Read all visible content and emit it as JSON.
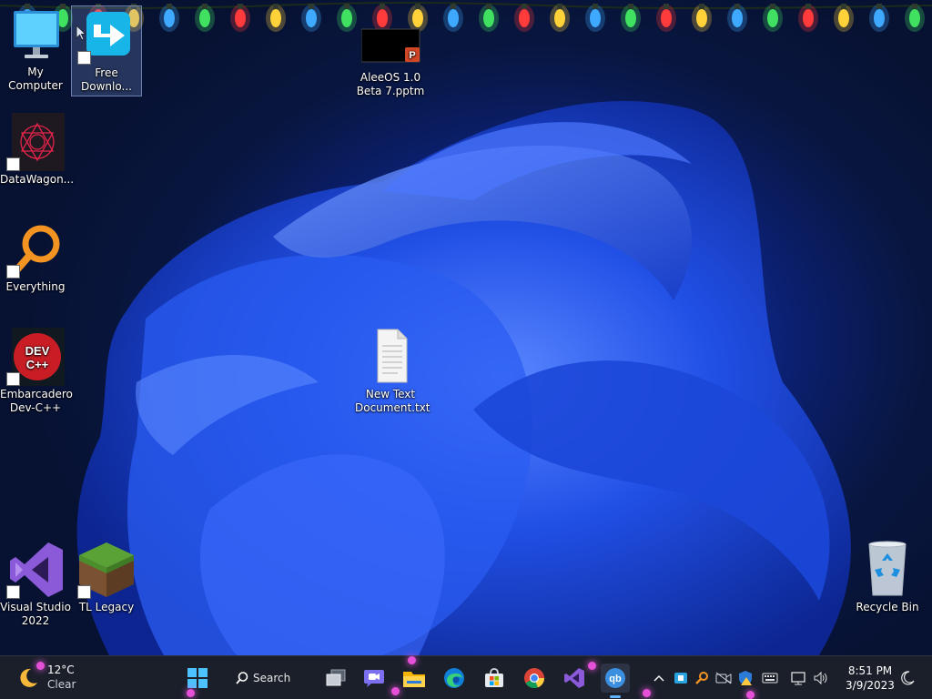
{
  "desktop": {
    "icons": {
      "my_computer": "My Computer",
      "free_download": "Free\nDownlo...",
      "aleeos": "AleeOS 1.0\nBeta 7.pptm",
      "datawagon": "DataWagon...",
      "everything": "Everything",
      "devcpp": "Embarcadero\nDev-C++",
      "new_text": "New Text\nDocument.txt",
      "visual_studio": "Visual Studio\n2022",
      "tl_legacy": "TL Legacy",
      "recycle_bin": "Recycle Bin"
    }
  },
  "taskbar": {
    "weather": {
      "temp": "12°C",
      "condition": "Clear",
      "icon": "moon-icon"
    },
    "search_label": "Search",
    "pinned": [
      "windows-start",
      "search",
      "task-view",
      "teams-chat",
      "file-explorer",
      "edge",
      "microsoft-store",
      "chrome",
      "visual-studio",
      "qb-app"
    ],
    "clock": {
      "time": "8:51 PM",
      "date": "3/9/2023"
    }
  },
  "colors": {
    "taskbar": "#1a1f2a",
    "accent": "#1d4fd6",
    "wallpaper_dark": "#071233"
  }
}
